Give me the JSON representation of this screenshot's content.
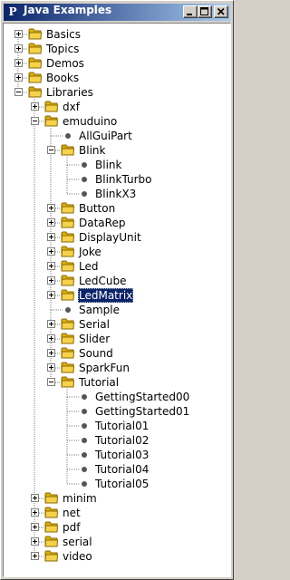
{
  "window": {
    "title": "Java Examples",
    "app_icon": "P",
    "colors": {
      "titlebar_start": "#0a246a",
      "titlebar_end": "#a6caf0",
      "selection": "#0a246a"
    },
    "controls": {
      "minimize": "minimize-icon",
      "maximize": "maximize-icon",
      "close": "close-icon"
    }
  },
  "tree": [
    {
      "label": "Basics",
      "depth": 0,
      "type": "folder",
      "expander": "collapsed"
    },
    {
      "label": "Topics",
      "depth": 0,
      "type": "folder",
      "expander": "collapsed"
    },
    {
      "label": "Demos",
      "depth": 0,
      "type": "folder",
      "expander": "collapsed"
    },
    {
      "label": "Books",
      "depth": 0,
      "type": "folder",
      "expander": "collapsed"
    },
    {
      "label": "Libraries",
      "depth": 0,
      "type": "folder",
      "expander": "expanded"
    },
    {
      "label": "dxf",
      "depth": 1,
      "type": "folder",
      "expander": "collapsed"
    },
    {
      "label": "emuduino",
      "depth": 1,
      "type": "folder",
      "expander": "expanded"
    },
    {
      "label": "AllGuiPart",
      "depth": 2,
      "type": "leaf"
    },
    {
      "label": "Blink",
      "depth": 2,
      "type": "folder",
      "expander": "expanded"
    },
    {
      "label": "Blink",
      "depth": 3,
      "type": "leaf"
    },
    {
      "label": "BlinkTurbo",
      "depth": 3,
      "type": "leaf"
    },
    {
      "label": "BlinkX3",
      "depth": 3,
      "type": "leaf"
    },
    {
      "label": "Button",
      "depth": 2,
      "type": "folder",
      "expander": "collapsed"
    },
    {
      "label": "DataRep",
      "depth": 2,
      "type": "folder",
      "expander": "collapsed"
    },
    {
      "label": "DisplayUnit",
      "depth": 2,
      "type": "folder",
      "expander": "collapsed"
    },
    {
      "label": "Joke",
      "depth": 2,
      "type": "folder",
      "expander": "collapsed"
    },
    {
      "label": "Led",
      "depth": 2,
      "type": "folder",
      "expander": "collapsed"
    },
    {
      "label": "LedCube",
      "depth": 2,
      "type": "folder",
      "expander": "collapsed"
    },
    {
      "label": "LedMatrix",
      "depth": 2,
      "type": "folder",
      "expander": "collapsed",
      "selected": true
    },
    {
      "label": "Sample",
      "depth": 2,
      "type": "leaf"
    },
    {
      "label": "Serial",
      "depth": 2,
      "type": "folder",
      "expander": "collapsed"
    },
    {
      "label": "Slider",
      "depth": 2,
      "type": "folder",
      "expander": "collapsed"
    },
    {
      "label": "Sound",
      "depth": 2,
      "type": "folder",
      "expander": "collapsed"
    },
    {
      "label": "SparkFun",
      "depth": 2,
      "type": "folder",
      "expander": "collapsed"
    },
    {
      "label": "Tutorial",
      "depth": 2,
      "type": "folder",
      "expander": "expanded"
    },
    {
      "label": "GettingStarted00",
      "depth": 3,
      "type": "leaf"
    },
    {
      "label": "GettingStarted01",
      "depth": 3,
      "type": "leaf"
    },
    {
      "label": "Tutorial01",
      "depth": 3,
      "type": "leaf"
    },
    {
      "label": "Tutorial02",
      "depth": 3,
      "type": "leaf"
    },
    {
      "label": "Tutorial03",
      "depth": 3,
      "type": "leaf"
    },
    {
      "label": "Tutorial04",
      "depth": 3,
      "type": "leaf"
    },
    {
      "label": "Tutorial05",
      "depth": 3,
      "type": "leaf"
    },
    {
      "label": "minim",
      "depth": 1,
      "type": "folder",
      "expander": "collapsed"
    },
    {
      "label": "net",
      "depth": 1,
      "type": "folder",
      "expander": "collapsed"
    },
    {
      "label": "pdf",
      "depth": 1,
      "type": "folder",
      "expander": "collapsed"
    },
    {
      "label": "serial",
      "depth": 1,
      "type": "folder",
      "expander": "collapsed"
    },
    {
      "label": "video",
      "depth": 1,
      "type": "folder",
      "expander": "collapsed"
    }
  ]
}
